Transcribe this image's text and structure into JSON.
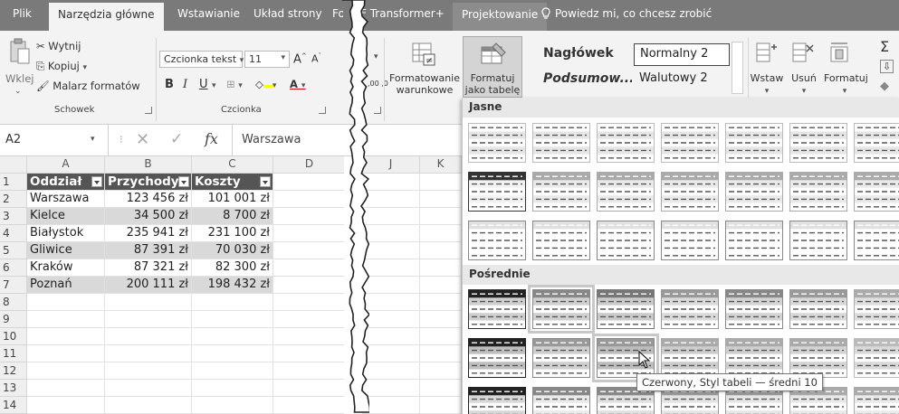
{
  "tabs": {
    "file": "Plik",
    "home": "Narzędzia główne",
    "insert": "Wstawianie",
    "layout": "Układ strony",
    "f_partial": "Fo",
    "transformer": "F Transformer+",
    "design": "Projektowanie"
  },
  "tell_me": "Powiedz mi, co chcesz zrobić",
  "clipboard": {
    "paste": "Wklej",
    "cut": "Wytnij",
    "copy": "Kopiuj",
    "painter": "Malarz formatów",
    "group": "Schowek"
  },
  "font": {
    "name": "Czcionka tekst",
    "size": "11",
    "group": "Czcionka",
    "bold": "B",
    "italic": "I",
    "underline": "U",
    "grow": "A",
    "shrink": "A"
  },
  "ribbon_right": {
    "cond_fmt": "Formatowanie warunkowe",
    "format_table": "Formatuj jako tabelę",
    "insert": "Wstaw",
    "delete": "Usuń",
    "format": "Formatuj",
    "sigma": "Σ",
    "dec": ",00 ,0"
  },
  "styles": {
    "heading": "Nagłówek",
    "normal2": "Normalny 2",
    "summary": "Podsumow...",
    "currency2": "Walutowy 2"
  },
  "formula": {
    "namebox": "A2",
    "fx": "fx",
    "value": "Warszawa"
  },
  "columns": [
    "A",
    "B",
    "C",
    "D"
  ],
  "right_columns": [
    "J",
    "K"
  ],
  "rows": [
    "1",
    "2",
    "3",
    "4",
    "5",
    "6",
    "7",
    "8",
    "9",
    "10",
    "11",
    "12",
    "13",
    "14"
  ],
  "table": {
    "headers": [
      "Oddział",
      "Przychody",
      "Koszty"
    ],
    "data": [
      [
        "Warszawa",
        "123 456 zł",
        "101 001 zł"
      ],
      [
        "Kielce",
        "34 500 zł",
        "8 700 zł"
      ],
      [
        "Białystok",
        "235 941 zł",
        "231 100 zł"
      ],
      [
        "Gliwice",
        "87 391 zł",
        "70 030 zł"
      ],
      [
        "Kraków",
        "87 321 zł",
        "82 300 zł"
      ],
      [
        "Poznań",
        "200 111 zł",
        "198 432 zł"
      ]
    ]
  },
  "gallery": {
    "light": "Jasne",
    "medium": "Pośrednie",
    "tooltip": "Czerwony, Styl tabeli — średni 10"
  },
  "colors": {
    "tabbar": "#7a7a7a",
    "header_fill": "#555555",
    "band": "#d9d9d9"
  }
}
